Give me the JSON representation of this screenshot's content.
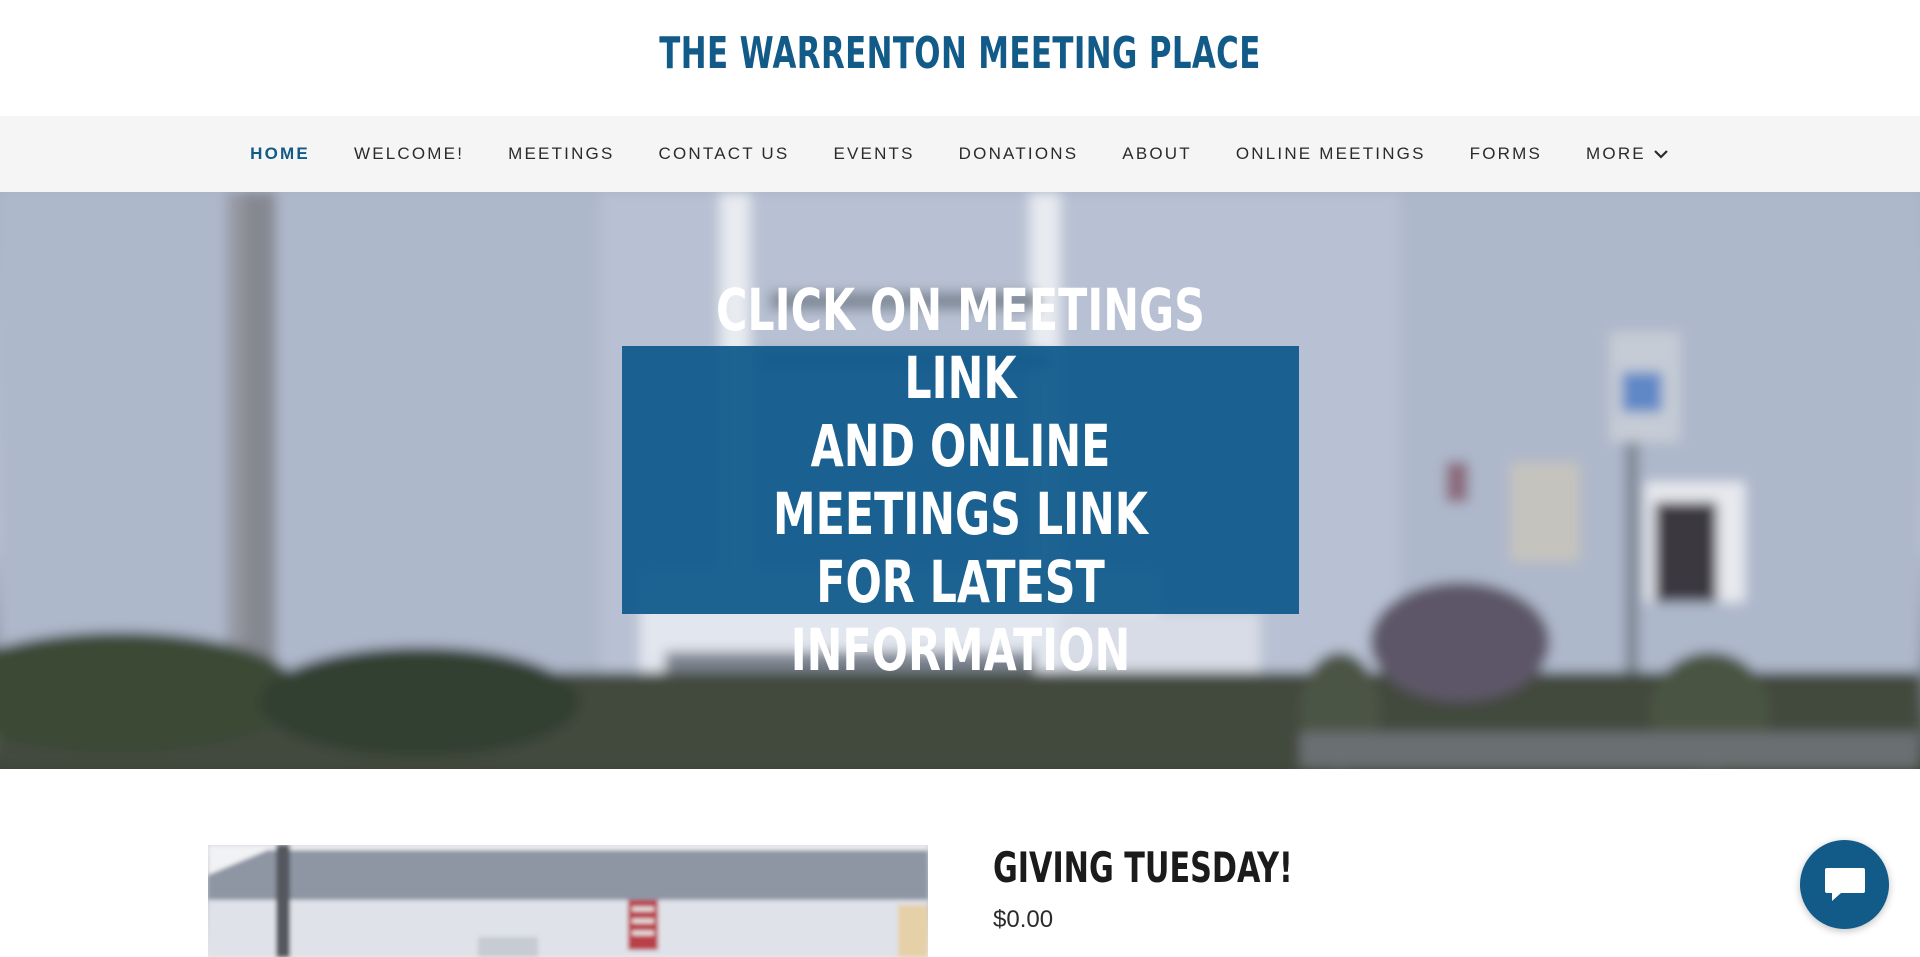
{
  "header": {
    "site_title": "THE WARRENTON MEETING PLACE"
  },
  "nav": {
    "items": [
      {
        "label": "HOME",
        "active": true
      },
      {
        "label": "WELCOME!",
        "active": false
      },
      {
        "label": "MEETINGS",
        "active": false
      },
      {
        "label": "CONTACT US",
        "active": false
      },
      {
        "label": "EVENTS",
        "active": false
      },
      {
        "label": "DONATIONS",
        "active": false
      },
      {
        "label": "ABOUT",
        "active": false
      },
      {
        "label": "ONLINE MEETINGS",
        "active": false
      },
      {
        "label": "FORMS",
        "active": false
      },
      {
        "label": "MORE",
        "active": false,
        "icon": "chevron-down-icon"
      }
    ]
  },
  "hero": {
    "line1": "CLICK ON MEETINGS LINK",
    "line2": "AND ONLINE MEETINGS LINK",
    "line3": "FOR LATEST INFORMATION"
  },
  "product": {
    "title": "GIVING TUESDAY!",
    "price": "$0.00"
  },
  "chat": {
    "icon": "chat-bubble-icon"
  },
  "colors": {
    "brand": "#125a87",
    "nav_bg": "#f5f5f5",
    "text": "#2b2b2b"
  }
}
